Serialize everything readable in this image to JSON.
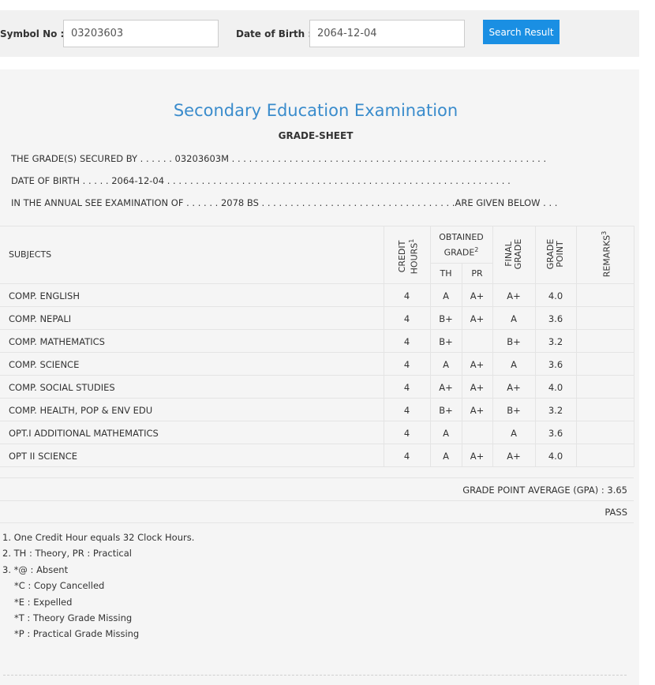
{
  "search": {
    "symbol_label": "Symbol No :",
    "symbol_value": "03203603",
    "dob_label": "Date of Birth :",
    "dob_value": "2064-12-04",
    "button_label": "Search Result"
  },
  "sheet": {
    "title": "Secondary Education Examination",
    "subtitle": "GRADE-SHEET",
    "line1_prefix": "THE GRADE(S) SECURED BY . . . . . . ",
    "line1_value": "03203603M",
    "line1_dots": " . . . . . . . . . . . . . . . . . . . . . . . . . . . . . . . . . . . . . . . . . . . . . . . . . . . . . . .",
    "line2_prefix": "DATE OF BIRTH . . . . . ",
    "line2_value": "2064-12-04",
    "line2_dots": " . . . . . . . . . . . . . . . . . . . . . . . . . . . . . . . . . . . . . . . . . . . . . . . . . . . . . . . . . . . .",
    "line3_prefix": "IN THE ANNUAL SEE EXAMINATION OF . . . . . . ",
    "line3_value": "2078 BS",
    "line3_dots": " . . . . . . . . . . . . . . . . . . . . . . . . . . . . . . . . . .",
    "line3_suffix": "ARE GIVEN BELOW . . ."
  },
  "table": {
    "headers": {
      "subjects": "SUBJECTS",
      "credit_line1": "CREDIT",
      "credit_line2": "HOURS",
      "credit_sup": "1",
      "obtained_line1": "OBTAINED",
      "obtained_line2": "GRADE",
      "obtained_sup": "2",
      "th": "TH",
      "pr": "PR",
      "final_line1": "FINAL",
      "final_line2": "GRADE",
      "point_line1": "GRADE",
      "point_line2": "POINT",
      "remarks": "REMARKS",
      "remarks_sup": "3"
    },
    "rows": [
      {
        "subject": "COMP. ENGLISH",
        "credit": "4",
        "th": "A",
        "pr": "A+",
        "final": "A+",
        "point": "4.0"
      },
      {
        "subject": "COMP. NEPALI",
        "credit": "4",
        "th": "B+",
        "pr": "A+",
        "final": "A",
        "point": "3.6"
      },
      {
        "subject": "COMP. MATHEMATICS",
        "credit": "4",
        "th": "B+",
        "pr": "",
        "final": "B+",
        "point": "3.2"
      },
      {
        "subject": "COMP. SCIENCE",
        "credit": "4",
        "th": "A",
        "pr": "A+",
        "final": "A",
        "point": "3.6"
      },
      {
        "subject": "COMP. SOCIAL STUDIES",
        "credit": "4",
        "th": "A+",
        "pr": "A+",
        "final": "A+",
        "point": "4.0"
      },
      {
        "subject": "COMP. HEALTH, POP & ENV EDU",
        "credit": "4",
        "th": "B+",
        "pr": "A+",
        "final": "B+",
        "point": "3.2"
      },
      {
        "subject": "OPT.I ADDITIONAL MATHEMATICS",
        "credit": "4",
        "th": "A",
        "pr": "",
        "final": "A",
        "point": "3.6"
      },
      {
        "subject": "OPT II SCIENCE",
        "credit": "4",
        "th": "A",
        "pr": "A+",
        "final": "A+",
        "point": "4.0"
      }
    ]
  },
  "result": {
    "gpa_text": "GRADE POINT AVERAGE (GPA) : 3.65",
    "status": "PASS"
  },
  "notes": [
    "1. One Credit Hour equals 32 Clock Hours.",
    "2. TH : Theory, PR : Practical",
    "3. *@ : Absent",
    "*C : Copy Cancelled",
    "*E : Expelled",
    "*T : Theory Grade Missing",
    "*P : Practical Grade Missing"
  ]
}
